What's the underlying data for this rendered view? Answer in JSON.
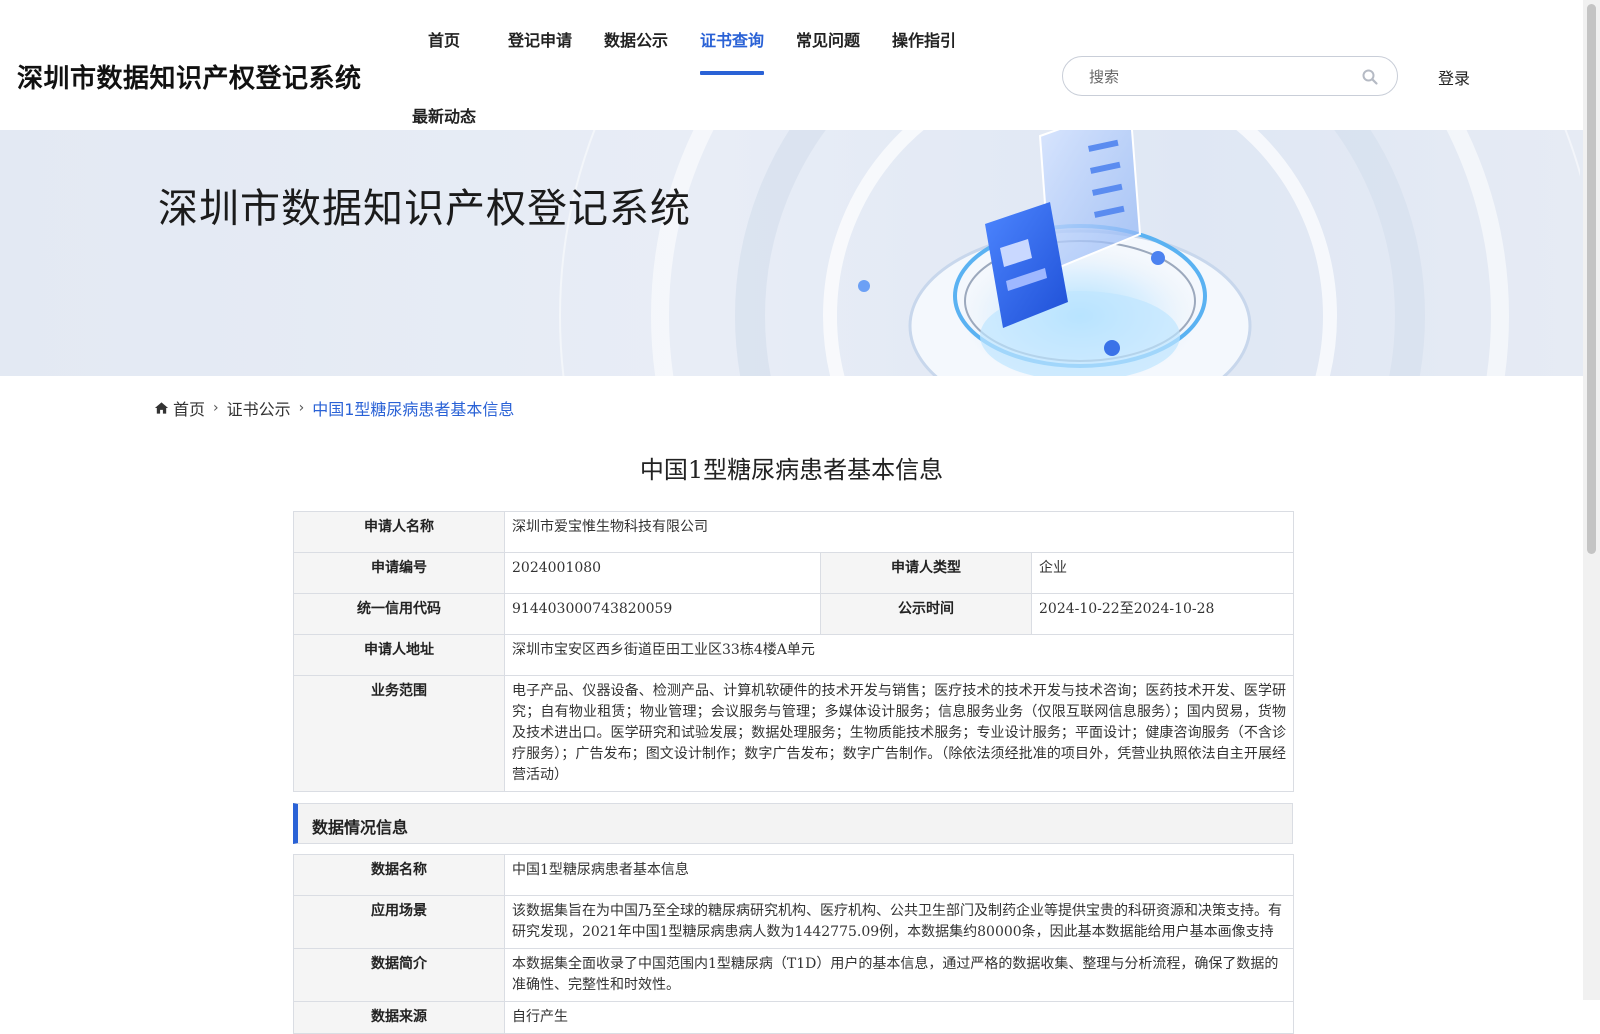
{
  "header": {
    "site_title": "深圳市数据知识产权登记系统",
    "nav": [
      {
        "label": "首页"
      },
      {
        "label": "登记申请"
      },
      {
        "label": "数据公示"
      },
      {
        "label": "证书查询",
        "active": true
      },
      {
        "label": "常见问题"
      },
      {
        "label": "操作指引"
      },
      {
        "label": "最新动态"
      }
    ],
    "search_placeholder": "搜索",
    "login_label": "登录",
    "accent_color": "#2a62d6"
  },
  "banner": {
    "title": "深圳市数据知识产权登记系统"
  },
  "breadcrumb": {
    "home": "首页",
    "level1": "证书公示",
    "current": "中国1型糖尿病患者基本信息"
  },
  "page_title": "中国1型糖尿病患者基本信息",
  "applicant": {
    "name_label": "申请人名称",
    "name": "深圳市爱宝惟生物科技有限公司",
    "app_no_label": "申请编号",
    "app_no": "2024001080",
    "type_label": "申请人类型",
    "type": "企业",
    "credit_code_label": "统一信用代码",
    "credit_code": "914403000743820059",
    "publish_time_label": "公示时间",
    "publish_time": "2024-10-22至2024-10-28",
    "address_label": "申请人地址",
    "address": "深圳市宝安区西乡街道臣田工业区33栋4楼A单元",
    "scope_label": "业务范围",
    "scope": "电子产品、仪器设备、检测产品、计算机软硬件的技术开发与销售；医疗技术的技术开发与技术咨询；医药技术开发、医学研究；自有物业租赁；物业管理；会议服务与管理；多媒体设计服务；信息服务业务（仅限互联网信息服务）；国内贸易，货物及技术进出口。医学研究和试验发展；数据处理服务；生物质能技术服务；专业设计服务；平面设计；健康咨询服务（不含诊疗服务）；广告发布；图文设计制作；数字广告发布；数字广告制作。（除依法须经批准的项目外，凭营业执照依法自主开展经营活动）"
  },
  "data_section": {
    "title": "数据情况信息",
    "name_label": "数据名称",
    "name": "中国1型糖尿病患者基本信息",
    "scenario_label": "应用场景",
    "scenario": "该数据集旨在为中国乃至全球的糖尿病研究机构、医疗机构、公共卫生部门及制药企业等提供宝贵的科研资源和决策支持。有研究发现，2021年中国1型糖尿病患病人数为1442775.09例，本数据集约80000条，因此基本数据能给用户基本画像支持",
    "intro_label": "数据简介",
    "intro": "本数据集全面收录了中国范围内1型糖尿病（T1D）用户的基本信息，通过严格的数据收集、整理与分析流程，确保了数据的准确性、完整性和时效性。",
    "source_label": "数据来源",
    "source": "自行产生"
  }
}
